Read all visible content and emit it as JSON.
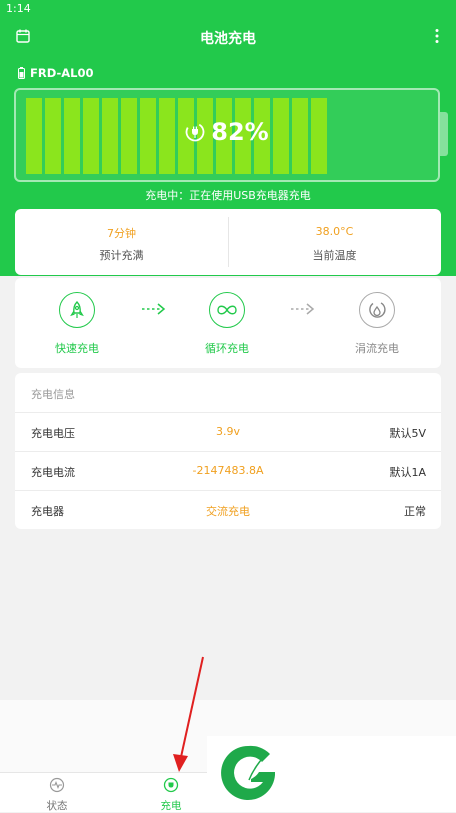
{
  "status_bar": {
    "time": "1:14"
  },
  "app_bar": {
    "title": "电池充电"
  },
  "device": {
    "name": "FRD-AL00"
  },
  "battery": {
    "percent_label": "82%",
    "level_fraction": 0.82,
    "cells_total": 20
  },
  "charge_status": "充电中：正在使用USB充电器充电",
  "stats": [
    {
      "value": "7分钟",
      "label": "预计充满"
    },
    {
      "value": "38.0°C",
      "label": "当前温度"
    }
  ],
  "modes": [
    {
      "label": "快速充电",
      "active": true
    },
    {
      "label": "循环充电",
      "active": true
    },
    {
      "label": "涓流充电",
      "active": false
    }
  ],
  "info": {
    "header": "充电信息",
    "rows": [
      {
        "name": "充电电压",
        "value": "3.9v",
        "note": "默认5V"
      },
      {
        "name": "充电电流",
        "value": "-2147483.8A",
        "note": "默认1A"
      },
      {
        "name": "充电器",
        "value": "交流充电",
        "note": "正常"
      }
    ]
  },
  "bottom_nav": [
    {
      "label": "状态",
      "active": false
    },
    {
      "label": "充电",
      "active": true
    }
  ],
  "colors": {
    "primary": "#22c94b",
    "cell": "#8be51d",
    "accent": "#f0a020",
    "annotation": "#e02020"
  }
}
